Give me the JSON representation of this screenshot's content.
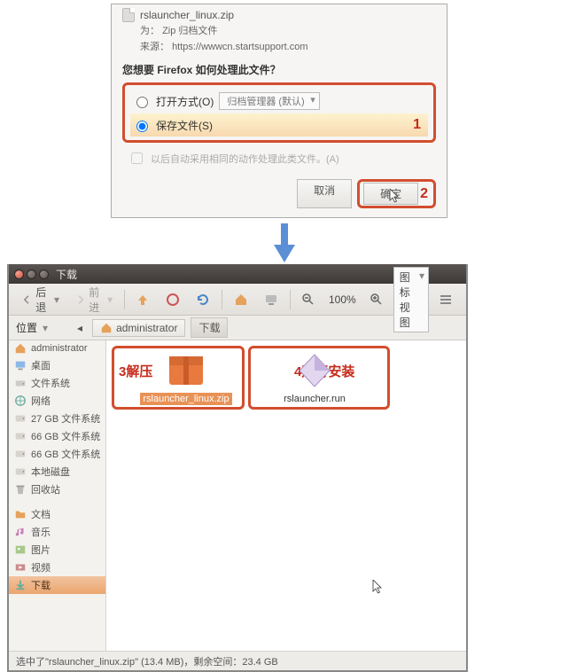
{
  "dialog": {
    "filename": "rslauncher_linux.zip",
    "type_label": "为：",
    "type_value": "Zip 归档文件",
    "source_label": "来源：",
    "source_value": "https://wwwcn.startsupport.com",
    "question": "您想要 Firefox 如何处理此文件？",
    "open_label": "打开方式(O)",
    "open_app": "归档管理器 (默认)",
    "save_label": "保存文件(S)",
    "auto_label": "以后自动采用相同的动作处理此类文件。(A)",
    "cancel": "取消",
    "ok": "确定",
    "marker1": "1",
    "marker2": "2"
  },
  "fm": {
    "title": "下载",
    "back": "后退",
    "forward": "前进",
    "zoom": "100%",
    "view": "图标视图",
    "loc_label": "位置",
    "crumb1": "administrator",
    "crumb2": "下载",
    "sidebar": [
      {
        "icon": "home",
        "label": "administrator"
      },
      {
        "icon": "desktop",
        "label": "桌面"
      },
      {
        "icon": "drive",
        "label": "文件系统"
      },
      {
        "icon": "network",
        "label": "网络"
      },
      {
        "icon": "disk",
        "label": "27 GB 文件系统"
      },
      {
        "icon": "disk",
        "label": "66 GB 文件系统"
      },
      {
        "icon": "disk",
        "label": "66 GB 文件系统"
      },
      {
        "icon": "disk",
        "label": "本地磁盘"
      },
      {
        "icon": "trash",
        "label": "回收站"
      },
      {
        "icon": "spacer",
        "label": ""
      },
      {
        "icon": "folder",
        "label": "文档"
      },
      {
        "icon": "music",
        "label": "音乐"
      },
      {
        "icon": "pic",
        "label": "图片"
      },
      {
        "icon": "video",
        "label": "视频"
      },
      {
        "icon": "download",
        "label": "下载"
      }
    ],
    "file1": "rslauncher_linux.zip",
    "file2": "rslauncher.run",
    "anno3": "3解压",
    "anno4": "4运行安装",
    "status": "选中了\"rslauncher_linux.zip\" (13.4 MB)，剩余空间：23.4 GB"
  }
}
